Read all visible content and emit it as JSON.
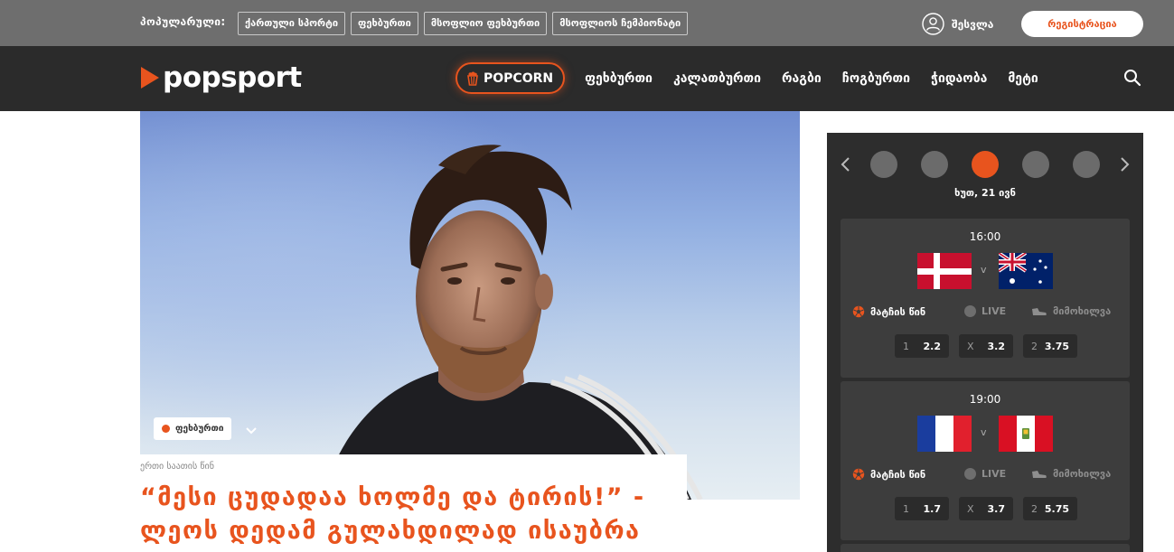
{
  "topbar": {
    "popular_label": "პოპულარული:",
    "popular_tags": [
      "ქართული სპორტი",
      "ფეხბურთი",
      "მსოფლიო ფეხბურთი",
      "მსოფლიოს ჩემპიონატი"
    ],
    "login_label": "შესვლა",
    "register_label": "რეგისტრაცია"
  },
  "navbar": {
    "logo_text": "popsport",
    "popcorn_label": "POPCORN",
    "items": [
      "ფეხბურთი",
      "კალათბურთი",
      "რაგბი",
      "ჩოგბურთი",
      "ჭიდაობა",
      "მეტი"
    ],
    "search_icon": "search-icon"
  },
  "hero": {
    "category": "ფეხბურთი",
    "time_ago": "ერთი საათის წინ",
    "title": "“მესი ცუდადაა ხოლმე და ტირის!” - ლეოს დედამ გულახდილად ისაუბრა"
  },
  "widget": {
    "date": "ხუთ, 21 ივნ",
    "active_day_index": 2,
    "day_count": 5,
    "pre_match_label": "მატჩის წინ",
    "live_label": "LIVE",
    "watch_label": "მიმოხილვა",
    "vs_label": "v",
    "matches": [
      {
        "time": "16:00",
        "home_flag": "denmark",
        "away_flag": "australia",
        "odds": [
          {
            "key": "1",
            "value": "2.2"
          },
          {
            "key": "X",
            "value": "3.2"
          },
          {
            "key": "2",
            "value": "3.75"
          }
        ]
      },
      {
        "time": "19:00",
        "home_flag": "france",
        "away_flag": "peru",
        "odds": [
          {
            "key": "1",
            "value": "1.7"
          },
          {
            "key": "X",
            "value": "3.7"
          },
          {
            "key": "2",
            "value": "5.75"
          }
        ]
      }
    ]
  },
  "colors": {
    "accent": "#e8541e",
    "topbar_bg": "#6e6e6e",
    "navbar_bg": "#2b2b2b",
    "widget_bg": "#2d2d2d"
  }
}
